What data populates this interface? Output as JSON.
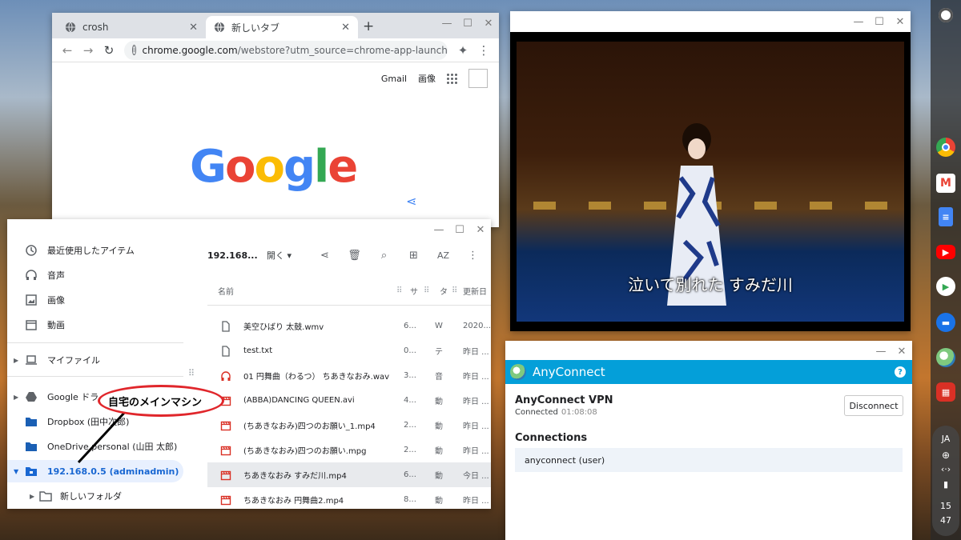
{
  "chrome": {
    "tabs": [
      {
        "label": "crosh",
        "active": false
      },
      {
        "label": "新しいタブ",
        "active": true
      }
    ],
    "url_host": "chrome.google.com",
    "url_path": "/webstore?utm_source=chrome-app-launcher",
    "gmail": "Gmail",
    "images": "画像",
    "doodle": "Google"
  },
  "files": {
    "sidebar": {
      "recent": "最近使用したアイテム",
      "audio": "音声",
      "images": "画像",
      "videos": "動画",
      "my_files": "マイファイル",
      "google_drive": "Google ドライブ",
      "dropbox": "Dropbox (田中次郎)",
      "onedrive": "OneDrive personal (山田 太郎)",
      "smb": "192.168.0.5 (adminadmin)",
      "new_folder": "新しいフォルダ"
    },
    "path": "192.168...",
    "open_label": "開く",
    "sort_label": "AZ",
    "columns": {
      "name": "名前",
      "size": "サ",
      "type": "タ",
      "date": "更新日"
    },
    "rows": [
      {
        "name": "美空ひばり 太鼓.wmv",
        "size": "6...",
        "type": "W",
        "date": "2020...",
        "icon": "file-icon"
      },
      {
        "name": "test.txt",
        "size": "0...",
        "type": "テ",
        "date": "昨日 ...",
        "icon": "file-icon"
      },
      {
        "name": "01 円舞曲（わるつ） ちあきなおみ.wav",
        "size": "3...",
        "type": "音",
        "date": "昨日 ...",
        "icon": "headphones-icon"
      },
      {
        "name": "(ABBA)DANCING QUEEN.avi",
        "size": "4...",
        "type": "動",
        "date": "昨日 ...",
        "icon": "video-icon"
      },
      {
        "name": "(ちあきなおみ)四つのお願い_1.mp4",
        "size": "2...",
        "type": "動",
        "date": "昨日 ...",
        "icon": "video-icon"
      },
      {
        "name": "(ちあきなおみ)四つのお願い.mpg",
        "size": "2...",
        "type": "動",
        "date": "昨日 ...",
        "icon": "video-icon"
      },
      {
        "name": "ちあきなおみ すみだ川.mp4",
        "size": "6...",
        "type": "動",
        "date": "今日 ...",
        "icon": "video-icon",
        "selected": true
      },
      {
        "name": "ちあきなおみ 円舞曲2.mp4",
        "size": "8...",
        "type": "動",
        "date": "昨日 ...",
        "icon": "video-icon"
      }
    ]
  },
  "video": {
    "subtitle": "泣いて別れた すみだ川"
  },
  "anyconnect": {
    "title": "AnyConnect",
    "vpn_name": "AnyConnect VPN",
    "status": "Connected",
    "duration": "01:08:08",
    "disconnect": "Disconnect",
    "connections_header": "Connections",
    "connection": "anyconnect (user)"
  },
  "shelf": {
    "ime": "JA",
    "hour": "15",
    "minute": "47"
  },
  "annotation": "自宅のメインマシン",
  "colors": {
    "anyconnect_blue": "#049fd9",
    "chrome_tabbar": "#dee1e6",
    "selected_blue": "#1967d2"
  }
}
